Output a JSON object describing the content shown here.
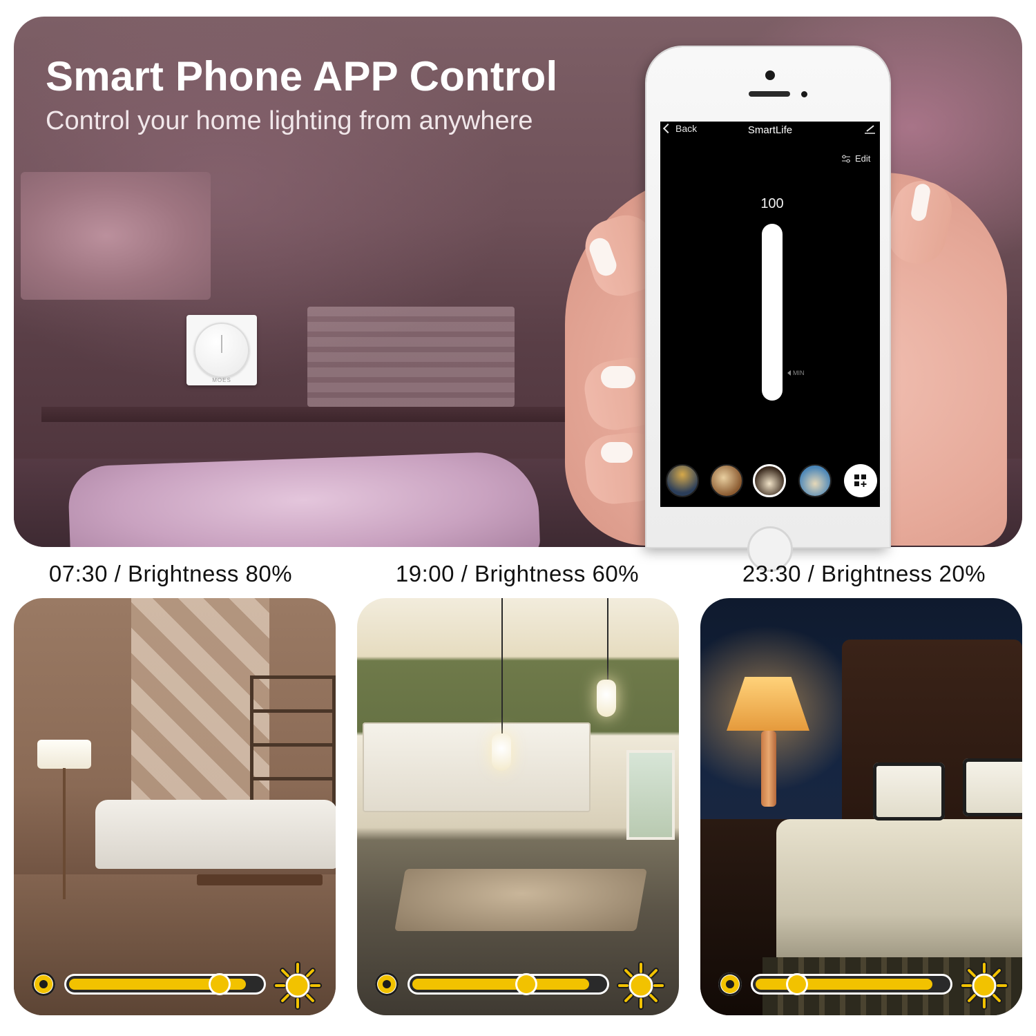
{
  "hero": {
    "title": "Smart Phone APP Control",
    "subtitle": "Control your home lighting from anywhere",
    "dimmer_brand": "MOES"
  },
  "app": {
    "back_label": "Back",
    "title": "SmartLife",
    "edit_label": "Edit",
    "brightness_value": "100",
    "min_label": "MIN",
    "scenes": [
      {
        "id": "scene-1",
        "active": false
      },
      {
        "id": "scene-2",
        "active": false
      },
      {
        "id": "scene-3",
        "active": true
      },
      {
        "id": "scene-4",
        "active": false
      }
    ]
  },
  "captions": [
    "07:30 / Brightness 80%",
    "19:00 / Brightness 60%",
    "23:30 / Brightness 20%"
  ],
  "sliders": [
    {
      "level": 0.8
    },
    {
      "level": 0.6
    },
    {
      "level": 0.2
    }
  ],
  "colors": {
    "accent_yellow": "#f2c200",
    "dark": "#1c1c1c"
  }
}
